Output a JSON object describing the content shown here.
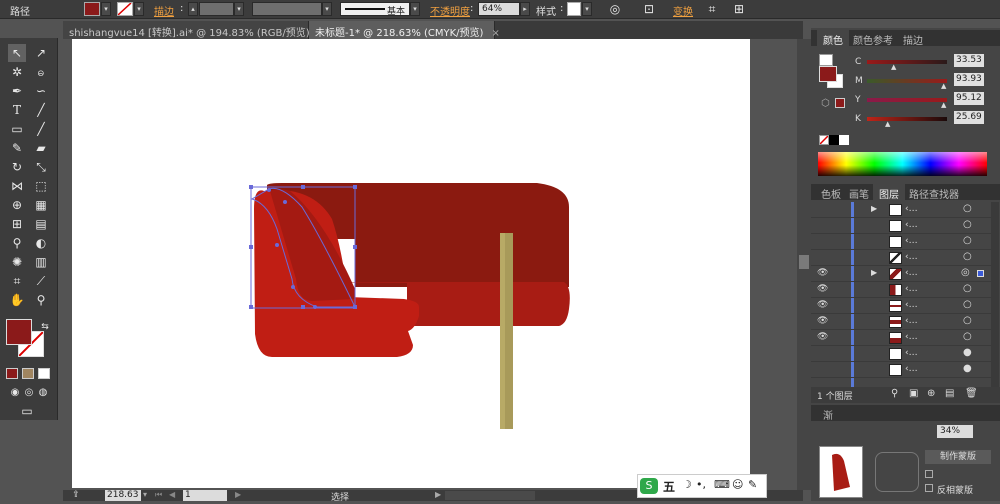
{
  "control_bar": {
    "path_label": "路径",
    "stroke_label": "描边",
    "stroke_style": "基本",
    "opacity_label": "不透明度",
    "opacity_value": "64%",
    "style_label": "样式",
    "transform_label": "变换",
    "fill_color": "#8b1a1a"
  },
  "tabs": [
    {
      "label": "shishangvue14 [转换].ai* @ 194.83% (RGB/预览)",
      "close": "×"
    },
    {
      "label": "未标题-1* @ 218.63% (CMYK/预览)",
      "close": "×"
    }
  ],
  "status": {
    "zoom": "218.63",
    "page": "1",
    "tool": "选择"
  },
  "color_panel": {
    "tabs": [
      "颜色",
      "颜色参考",
      "描边"
    ],
    "channels": [
      {
        "name": "C",
        "value": "33.53"
      },
      {
        "name": "M",
        "value": "93.93"
      },
      {
        "name": "Y",
        "value": "95.12"
      },
      {
        "name": "K",
        "value": "25.69"
      }
    ]
  },
  "layers_panel": {
    "tabs": [
      "色板",
      "画笔",
      "图层",
      "路径查找器"
    ],
    "count_label": "1 个图层"
  },
  "bottom_panel": {
    "tab_label": "渐",
    "input_value": "34%",
    "btn1": "制作蒙版",
    "btn2": "反相蒙版"
  },
  "ime": {
    "label": "五"
  }
}
